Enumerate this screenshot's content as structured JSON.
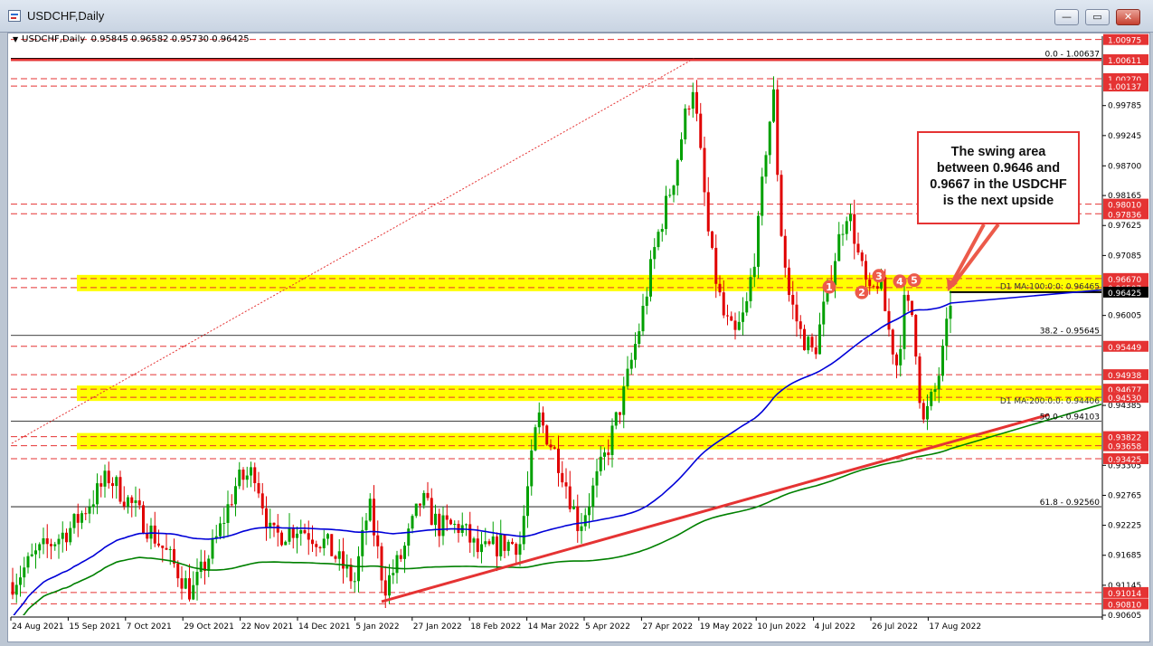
{
  "window": {
    "title": "USDCHF,Daily",
    "controls": {
      "minimize": "—",
      "restore": "▭",
      "close": "✕"
    }
  },
  "symbol_info": {
    "symbol": "USDCHF,Daily",
    "ohlc": "0.95845 0.96582 0.95730 0.96425"
  },
  "callout": {
    "lines": [
      "The swing area",
      "between 0.9646 and",
      "0.9667 in the USDCHF",
      "is the next upside"
    ]
  },
  "colors": {
    "background": "#ffffff",
    "bull_candle": "#00a000",
    "bear_candle": "#e00000",
    "ma100": "#0000d8",
    "ma200": "#008000",
    "trendline": "#e53333",
    "highlight_zone": "#ffff00",
    "fib_line": "#e53333",
    "level_label_bg": "#e53333"
  },
  "chart_data": {
    "type": "candlestick",
    "title": "USDCHF,Daily",
    "ylim": [
      0.90605,
      1.01035
    ],
    "x_labels": [
      "24 Aug 2021",
      "15 Sep 2021",
      "7 Oct 2021",
      "29 Oct 2021",
      "22 Nov 2021",
      "14 Dec 2021",
      "5 Jan 2022",
      "27 Jan 2022",
      "18 Feb 2022",
      "14 Mar 2022",
      "5 Apr 2022",
      "27 Apr 2022",
      "19 May 2022",
      "10 Jun 2022",
      "4 Jul 2022",
      "26 Jul 2022",
      "17 Aug 2022"
    ],
    "y_ticks": [
      "0.99785",
      "0.99245",
      "0.98700",
      "0.98165",
      "0.97625",
      "0.97085",
      "0.96005",
      "0.94385",
      "0.93305",
      "0.92765",
      "0.92225",
      "0.91685",
      "0.91145",
      "0.90605"
    ],
    "price_levels": [
      "1.00975",
      "1.00611",
      "1.00270",
      "1.00137",
      "0.98010",
      "0.97836",
      "0.96670",
      "0.96507",
      "0.95449",
      "0.94938",
      "0.94677",
      "0.94530",
      "0.93822",
      "0.93658",
      "0.93425",
      "0.91014",
      "0.90810"
    ],
    "current_price": "0.96425",
    "zones": [
      {
        "from": 0.96507,
        "to": 0.9667
      },
      {
        "from": 0.9453,
        "to": 0.94677
      },
      {
        "from": 0.93658,
        "to": 0.93822
      }
    ],
    "fib_labels": [
      {
        "text": "0.0 - 1.00637",
        "value": 1.00637
      },
      {
        "text": "38.2 - 0.95645",
        "value": 0.95645
      },
      {
        "text": "50.0 - 0.94103",
        "value": 0.94103
      },
      {
        "text": "61.8 - 0.92560",
        "value": 0.9256
      }
    ],
    "ma_labels": [
      {
        "text": "D1 MA:100:0:0: 0.96465",
        "value": 0.96465
      },
      {
        "text": "D1 MA:200:0:0: 0.94406",
        "value": 0.94406
      }
    ],
    "markers": [
      "1",
      "2",
      "3",
      "4",
      "5"
    ],
    "trendline": {
      "from": {
        "date": "5 Jan 2022",
        "value": 0.9085
      },
      "to": {
        "date": "17 Aug 2022",
        "value": 0.9422
      }
    },
    "series": [
      {
        "name": "USDCHF",
        "kind": "ohlc"
      },
      {
        "name": "D1 MA:100",
        "kind": "line"
      },
      {
        "name": "D1 MA:200",
        "kind": "line"
      }
    ]
  }
}
